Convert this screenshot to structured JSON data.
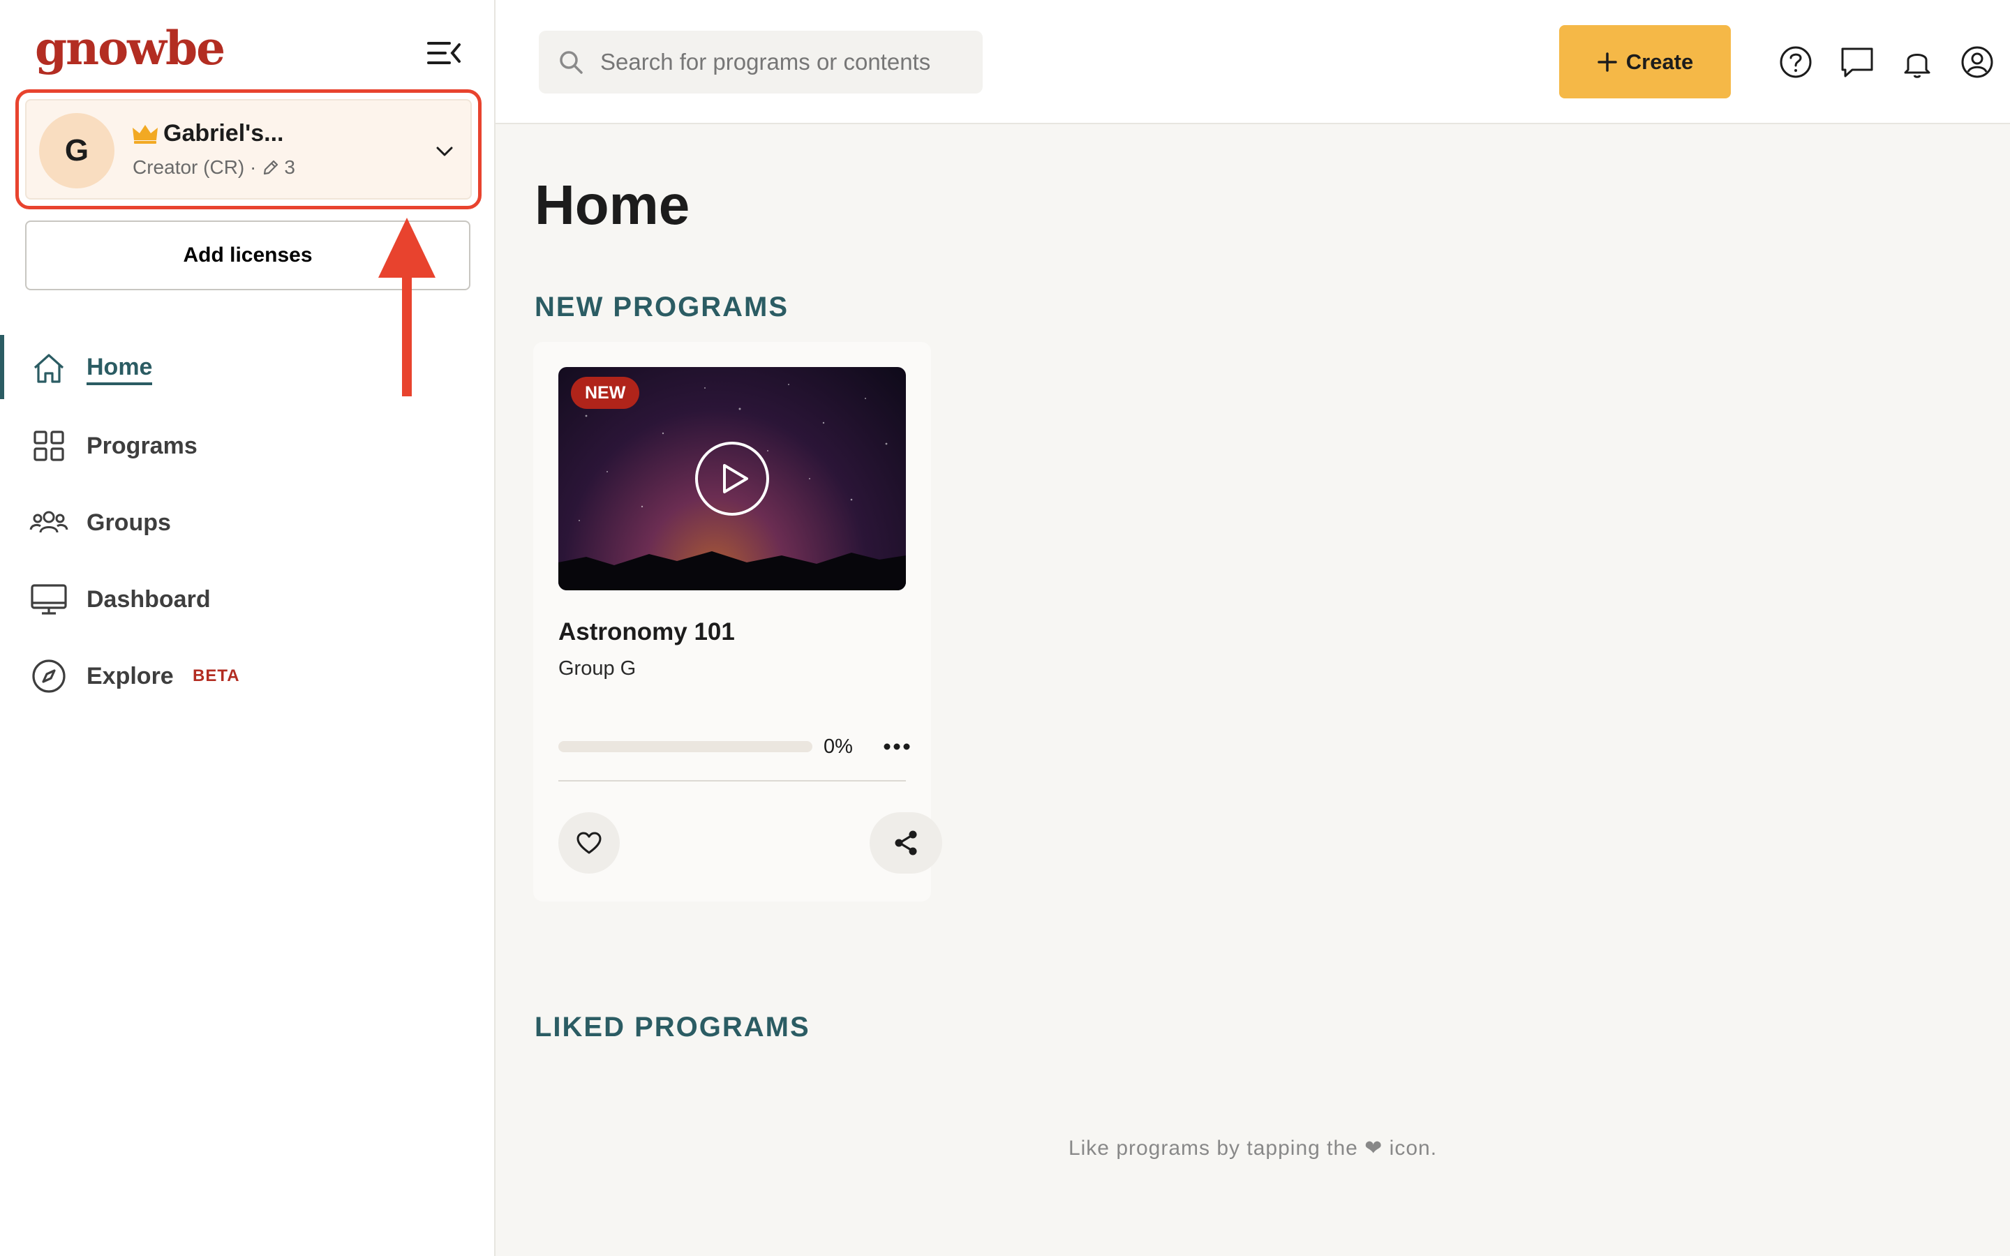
{
  "app": {
    "logo": "gnowbe",
    "brand_color": "#b32d22",
    "accent_color": "#2b5c63",
    "annotation_color": "#e8432e"
  },
  "sidebar": {
    "collapse_icon": "collapse-sidebar-icon",
    "org": {
      "avatar_letter": "G",
      "name": "Gabriel's...",
      "role": "Creator (CR) ·",
      "edit_count": "3",
      "badge_icon": "crown-icon"
    },
    "add_licenses_label": "Add licenses",
    "nav": [
      {
        "label": "Home",
        "icon": "home-icon",
        "active": true
      },
      {
        "label": "Programs",
        "icon": "grid-icon"
      },
      {
        "label": "Groups",
        "icon": "users-icon"
      },
      {
        "label": "Dashboard",
        "icon": "monitor-icon"
      },
      {
        "label": "Explore",
        "icon": "compass-icon",
        "badge": "BETA"
      }
    ]
  },
  "topbar": {
    "search_placeholder": "Search for programs or contents",
    "create_label": "Create",
    "icons": [
      "help-icon",
      "chat-icon",
      "bell-icon",
      "account-icon"
    ]
  },
  "main": {
    "title": "Home",
    "new_programs_title": "NEW PROGRAMS",
    "liked_programs_title": "LIKED PROGRAMS",
    "liked_empty_text": "Like programs by tapping the ❤ icon.",
    "programs": [
      {
        "badge": "NEW",
        "title": "Astronomy 101",
        "group": "Group G",
        "progress_pct": "0%",
        "progress_value": 0
      }
    ]
  }
}
